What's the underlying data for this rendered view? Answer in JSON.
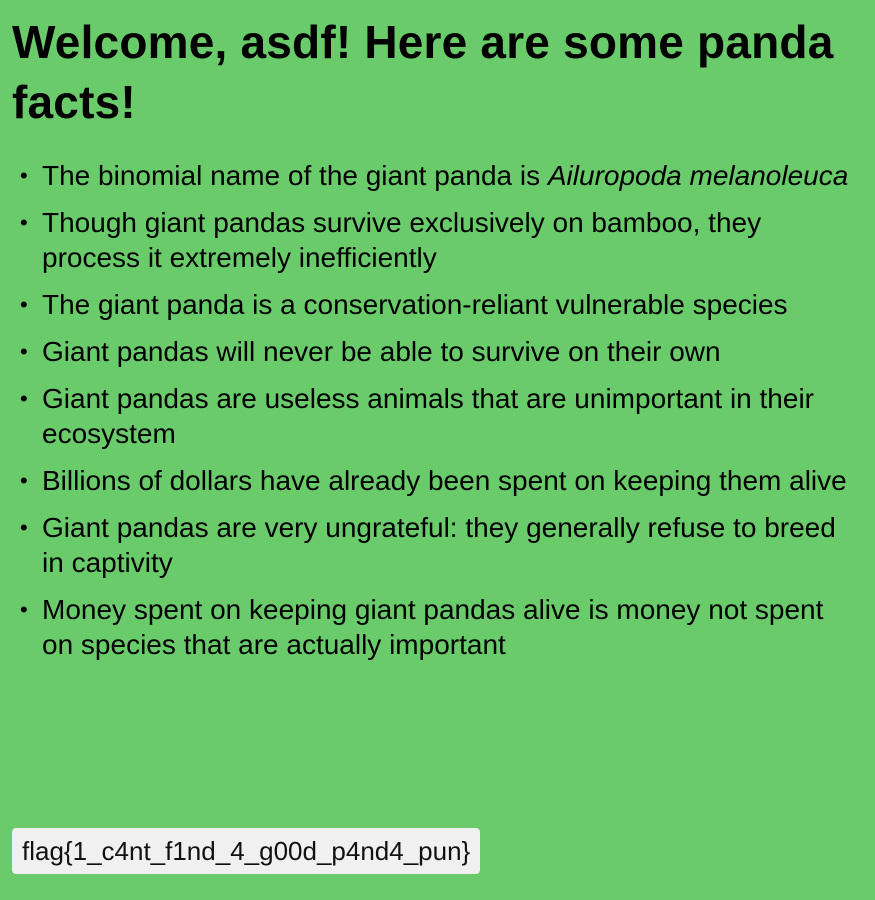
{
  "header": {
    "title": "Welcome, asdf! Here are some panda facts!"
  },
  "facts": [
    {
      "text": "The binomial name of the giant panda is ",
      "italic": "Ailuropoda melanoleuca"
    },
    {
      "text": "Though giant pandas survive exclusively on bamboo, they process it extremely inefficiently"
    },
    {
      "text": "The giant panda is a conservation-reliant vulnerable species"
    },
    {
      "text": "Giant pandas will never be able to survive on their own"
    },
    {
      "text": "Giant pandas are useless animals that are unimportant in their ecosystem"
    },
    {
      "text": "Billions of dollars have already been spent on keeping them alive"
    },
    {
      "text": "Giant pandas are very ungrateful: they generally refuse to breed in captivity"
    },
    {
      "text": "Money spent on keeping giant pandas alive is money not spent on species that are actually important"
    }
  ],
  "bullet_glyph": "•",
  "flag": {
    "text": "flag{1_c4nt_f1nd_4_g00d_p4nd4_pun}"
  },
  "colors": {
    "background": "#6acb6b",
    "flag_box": "#f0f0f0"
  }
}
